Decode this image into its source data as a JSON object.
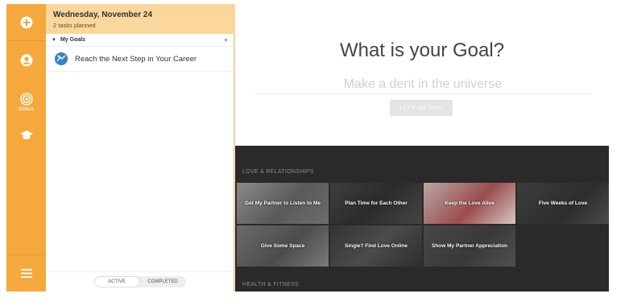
{
  "rail": {
    "goals_label": "GOALS",
    "icons": [
      "add-icon",
      "user-icon",
      "target-icon",
      "graduation-cap-icon",
      "menu-icon"
    ],
    "accent": "#f5a83c"
  },
  "tasks": {
    "date": "Wednesday, November 24",
    "planned": "2 tasks planned",
    "group_label": "My Goals",
    "goal_item": "Reach the Next Step in Your Career",
    "filter_active": "ACTIVE",
    "filter_completed": "COMPLETED"
  },
  "hero": {
    "title": "What is your Goal?",
    "placeholder": "Make a dent in the universe",
    "button": "LET'S DO THIS!"
  },
  "sections": {
    "love": "LOVE & RELATIONSHIPS",
    "health": "HEALTH & FITNESS"
  },
  "cards": [
    "Get My Partner to Listen to Me",
    "Plan Time for Each Other",
    "Keep the Love Alive",
    "Five Weeks of Love",
    "Give Some Space",
    "Single? Find Love Online",
    "Show My Partner Appreciation"
  ]
}
